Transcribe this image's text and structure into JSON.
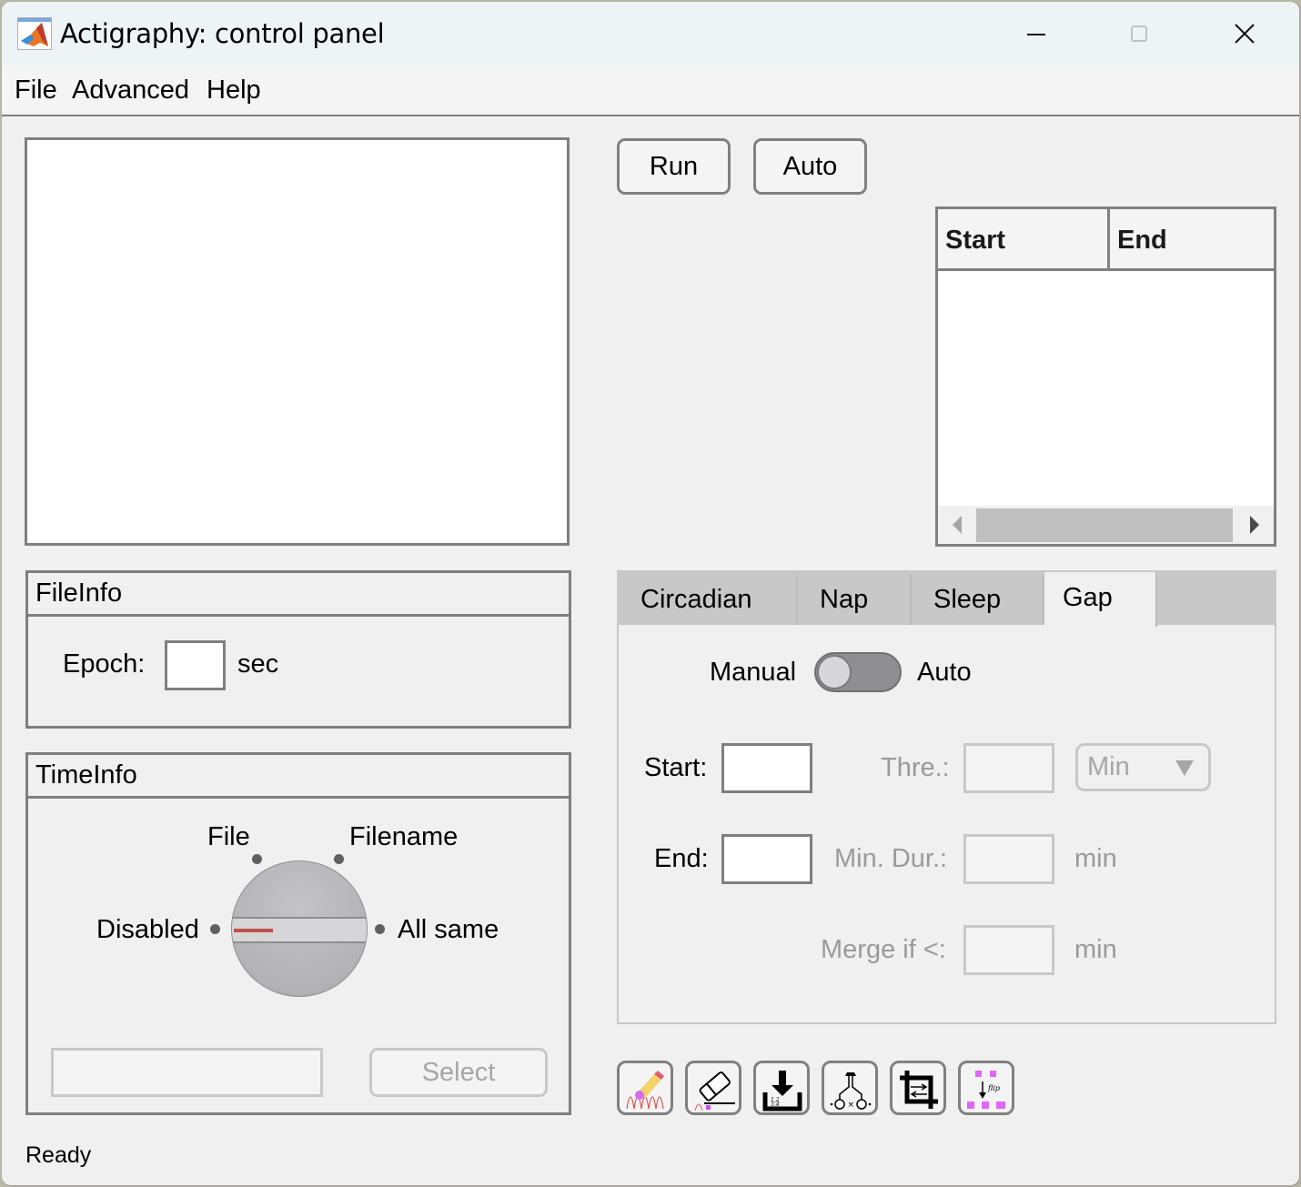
{
  "window": {
    "title": "Actigraphy: control panel",
    "app_icon": "matlab-icon",
    "controls": [
      "minimize-icon",
      "maximize-icon",
      "close-icon"
    ]
  },
  "menu": {
    "items": [
      {
        "label": "File"
      },
      {
        "label": "Advanced"
      },
      {
        "label": "Help"
      }
    ]
  },
  "toolbar": {
    "run_label": "Run",
    "auto_label": "Auto"
  },
  "table": {
    "columns": [
      "Start",
      "End"
    ],
    "rows": []
  },
  "file_info": {
    "title": "FileInfo",
    "epoch_label": "Epoch:",
    "epoch_value": "",
    "epoch_unit": "sec"
  },
  "time_info": {
    "title": "TimeInfo",
    "knob_options": [
      "Disabled",
      "File",
      "Filename",
      "All same"
    ],
    "knob_selected": "Disabled",
    "path_value": "",
    "select_label": "Select"
  },
  "tabs": {
    "items": [
      {
        "label": "Circadian"
      },
      {
        "label": "Nap"
      },
      {
        "label": "Sleep"
      },
      {
        "label": "Gap"
      }
    ],
    "active": "Gap"
  },
  "gap": {
    "switch_left": "Manual",
    "switch_right": "Auto",
    "switch_value": "Manual",
    "start_label": "Start:",
    "start_value": "",
    "end_label": "End:",
    "end_value": "",
    "threshold_label": "Thre.:",
    "threshold_value": "",
    "unit_dropdown": "Min",
    "min_dur_label": "Min. Dur.:",
    "min_dur_value": "",
    "min_dur_unit": "min",
    "merge_label": "Merge if <:",
    "merge_value": "",
    "merge_unit": "min"
  },
  "tool_buttons": [
    {
      "icon": "draw-pencil-icon"
    },
    {
      "icon": "eraser-icon"
    },
    {
      "icon": "import-data-icon"
    },
    {
      "icon": "merge-branch-icon"
    },
    {
      "icon": "crop-icon"
    },
    {
      "icon": "flip-icon"
    }
  ],
  "colors": {
    "accent_red": "#c0504d",
    "magenta": "#e066ff",
    "border": "#7f7f7f"
  },
  "status": {
    "text": "Ready"
  }
}
